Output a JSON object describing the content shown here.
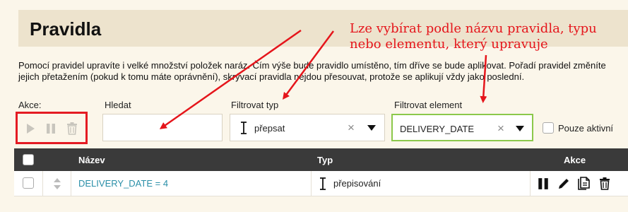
{
  "page": {
    "title": "Pravidla",
    "description_line1": "Pomocí pravidel upravíte i velké množství položek naráz. Čím výše bude pravidlo umístěno, tím dříve se bude aplikovat. Pořadí pravidel změníte",
    "description_line2": "jejich přetažením (pokud k tomu máte oprávnění), skrývací pravidla nejdou přesouvat, protože se aplikují vždy jako poslední."
  },
  "annotation": {
    "line1": "Lze vybírat podle názvu pravidla, typu",
    "line2": "nebo elementu, který upravuje"
  },
  "filters": {
    "actions_label": "Akce:",
    "search_label": "Hledat",
    "search_value": "",
    "type_label": "Filtrovat typ",
    "type_value": "přepsat",
    "element_label": "Filtrovat element",
    "element_value": "DELIVERY_DATE",
    "only_active_label": "Pouze aktivní"
  },
  "table": {
    "columns": [
      "Název",
      "Typ",
      "Akce"
    ],
    "rows": [
      {
        "name": "DELIVERY_DATE = 4",
        "type": "přepisování"
      }
    ]
  },
  "icons": [
    "play-icon",
    "pause-icon",
    "trash-icon",
    "text-cursor-icon",
    "close-icon",
    "chevron-down-icon",
    "sort-handle-icon",
    "pencil-icon",
    "copy-icon"
  ],
  "colors": {
    "annotation": "#e5151b",
    "header_bg": "#ede3cd",
    "table_head_bg": "#3a3a3a",
    "link": "#2a8fa8",
    "active_border": "#8cc84b"
  }
}
